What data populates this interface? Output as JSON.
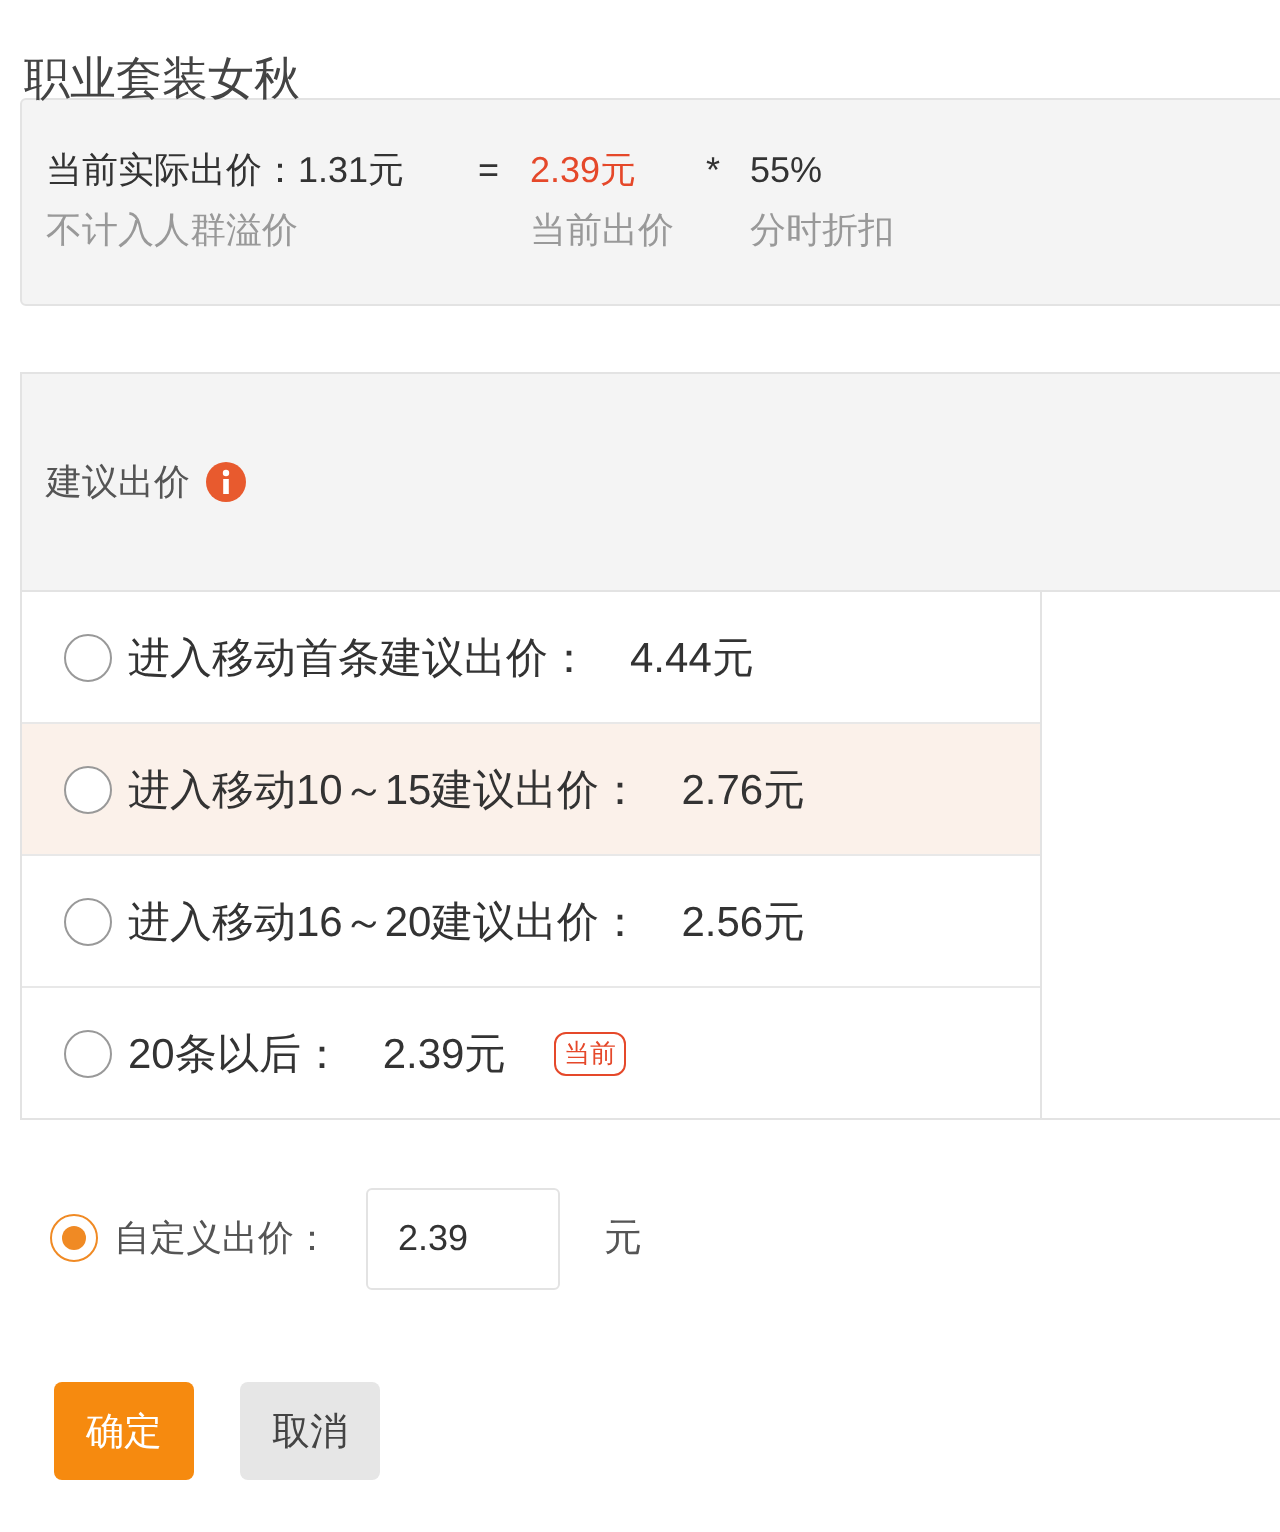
{
  "title": "职业套装女秋",
  "summary": {
    "actual": "当前实际出价：1.31元",
    "equals": "=",
    "current": "2.39元",
    "times": "*",
    "discount": "55%",
    "actual_note": "不计入人群溢价",
    "current_note": "当前出价",
    "discount_note": "分时折扣"
  },
  "suggestion": {
    "heading": "建议出价",
    "options": [
      {
        "label": "进入移动首条建议出价：",
        "value": "4.44元",
        "selected": false,
        "highlighted": false
      },
      {
        "label": "进入移动10～15建议出价：",
        "value": "2.76元",
        "selected": false,
        "highlighted": true
      },
      {
        "label": "进入移动16～20建议出价：",
        "value": "2.56元",
        "selected": false,
        "highlighted": false
      },
      {
        "label": "20条以后：",
        "value": "2.39元",
        "selected": false,
        "highlighted": false,
        "badge": "当前"
      }
    ]
  },
  "custom": {
    "label": "自定义出价：",
    "selected": true,
    "value": "2.39",
    "unit": "元"
  },
  "buttons": [
    {
      "label": "确定",
      "kind": "primary"
    },
    {
      "label": "取消",
      "kind": "secondary"
    }
  ]
}
